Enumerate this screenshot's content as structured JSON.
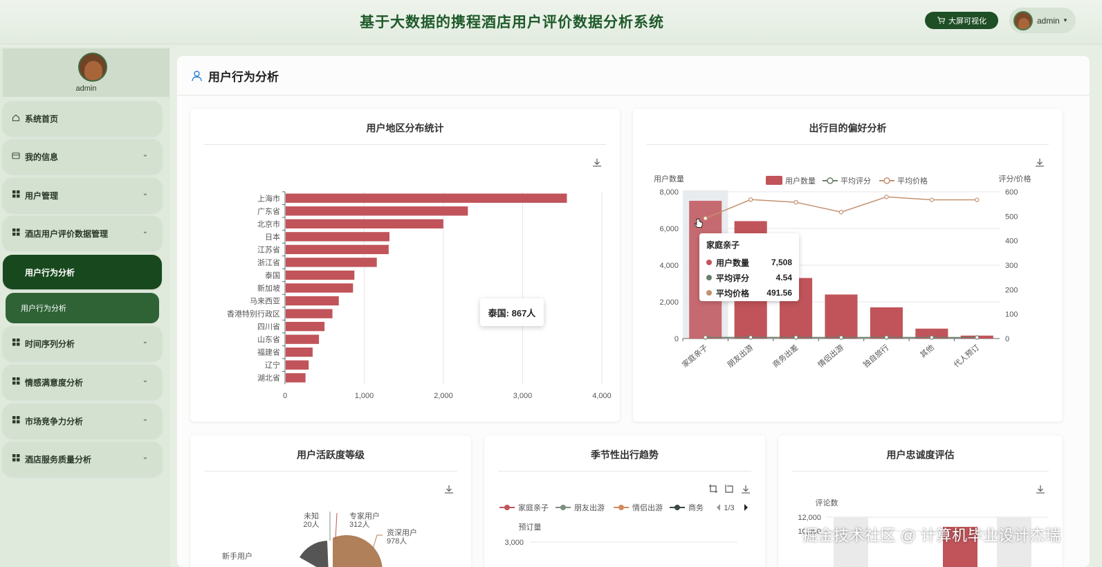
{
  "header": {
    "title": "基于大数据的携程酒店用户评价数据分析系统",
    "bigscreen_label": "大屏可视化",
    "user_name": "admin",
    "user_caret": "▾"
  },
  "sidebar": {
    "profile_name": "admin",
    "items": [
      {
        "label": "系统首页",
        "icon": "home-icon",
        "has_chevron": false
      },
      {
        "label": "我的信息",
        "icon": "card-icon",
        "has_chevron": true
      },
      {
        "label": "用户管理",
        "icon": "grid-icon",
        "has_chevron": true
      },
      {
        "label": "酒店用户评价数据管理",
        "icon": "grid-icon",
        "has_chevron": true
      },
      {
        "label": "用户行为分析",
        "icon": "",
        "has_chevron": false,
        "active": true
      },
      {
        "label": "用户行为分析",
        "icon": "",
        "has_chevron": false,
        "sub": true
      },
      {
        "label": "时间序列分析",
        "icon": "grid-icon",
        "has_chevron": true
      },
      {
        "label": "情感满意度分析",
        "icon": "grid-icon",
        "has_chevron": true
      },
      {
        "label": "市场竞争力分析",
        "icon": "grid-icon",
        "has_chevron": true
      },
      {
        "label": "酒店服务质量分析",
        "icon": "grid-icon",
        "has_chevron": true
      }
    ],
    "chevron": "⌄"
  },
  "main": {
    "title": "用户行为分析",
    "cards": {
      "region": {
        "title": "用户地区分布统计",
        "tooltip": "泰国: 867人"
      },
      "purpose": {
        "title": "出行目的偏好分析",
        "tooltip": {
          "title": "家庭亲子",
          "rows": [
            {
              "label": "用户数量",
              "value": "7,508",
              "color": "#c0545a"
            },
            {
              "label": "平均评分",
              "value": "4.54",
              "color": "#6b7f6d"
            },
            {
              "label": "平均价格",
              "value": "491.56",
              "color": "#c49070"
            }
          ]
        }
      },
      "activity": {
        "title": "用户活跃度等级"
      },
      "seasonal": {
        "title": "季节性出行趋势",
        "page": "1/3",
        "ylabel": "预订量",
        "ytick": "3,000"
      },
      "loyalty": {
        "title": "用户忠诚度评估",
        "ylabel": "评论数",
        "yticks": [
          "12,000",
          "10,000"
        ]
      }
    }
  },
  "watermark": "掘金技术社区 @ 计算机毕业设计杰瑞",
  "chart_data": [
    {
      "type": "bar",
      "orientation": "horizontal",
      "title": "用户地区分布统计",
      "categories": [
        "上海市",
        "广东省",
        "北京市",
        "日本",
        "江苏省",
        "浙江省",
        "泰国",
        "新加坡",
        "马来西亚",
        "香港特别行政区",
        "四川省",
        "山东省",
        "福建省",
        "辽宁",
        "湖北省"
      ],
      "values": [
        3550,
        2300,
        1990,
        1310,
        1300,
        1150,
        867,
        850,
        670,
        590,
        490,
        420,
        340,
        290,
        250
      ],
      "xticks": [
        "0",
        "1,000",
        "2,000",
        "3,000",
        "4,000"
      ],
      "xlim": [
        0,
        4000
      ],
      "color": "#c0545a"
    },
    {
      "type": "bar",
      "title": "出行目的偏好分析",
      "categories": [
        "家庭亲子",
        "朋友出游",
        "商务出差",
        "情侣出游",
        "独自旅行",
        "其他",
        "代人预订"
      ],
      "left_axis_label": "用户数量",
      "right_axis_label": "评分/价格",
      "left_ticks": [
        "0",
        "2,000",
        "4,000",
        "6,000",
        "8,000"
      ],
      "right_ticks": [
        "0",
        "100",
        "200",
        "300",
        "400",
        "500",
        "600"
      ],
      "ylim_left": [
        0,
        8000
      ],
      "ylim_right": [
        0,
        600
      ],
      "legend": [
        "用户数量",
        "平均评分",
        "平均价格"
      ],
      "series": [
        {
          "name": "用户数量",
          "type": "bar",
          "axis": "left",
          "color": "#c0545a",
          "values": [
            7508,
            6400,
            3300,
            2400,
            1700,
            540,
            160
          ]
        },
        {
          "name": "平均评分",
          "type": "line",
          "axis": "right",
          "color": "#6b7f6d",
          "values": [
            4.54,
            4.5,
            4.5,
            4.4,
            4.5,
            4.4,
            4.4
          ]
        },
        {
          "name": "平均价格",
          "type": "line",
          "axis": "right",
          "color": "#c49070",
          "values": [
            491.56,
            568,
            557,
            517,
            579,
            567,
            567
          ]
        }
      ]
    },
    {
      "type": "pie",
      "title": "用户活跃度等级",
      "labels": [
        {
          "name": "未知",
          "value": "20人"
        },
        {
          "name": "专家用户",
          "value": "312人"
        },
        {
          "name": "资深用户",
          "value": "978人"
        },
        {
          "name": "新手用户",
          "value": ""
        }
      ]
    },
    {
      "type": "line",
      "title": "季节性出行趋势",
      "legend": [
        {
          "name": "家庭亲子",
          "color": "#c0545a"
        },
        {
          "name": "朋友出游",
          "color": "#7d8f7f"
        },
        {
          "name": "情侣出游",
          "color": "#d18c5e"
        },
        {
          "name": "商务",
          "color": "#3b4a40"
        }
      ]
    },
    {
      "type": "bar",
      "title": "用户忠诚度评估"
    }
  ]
}
